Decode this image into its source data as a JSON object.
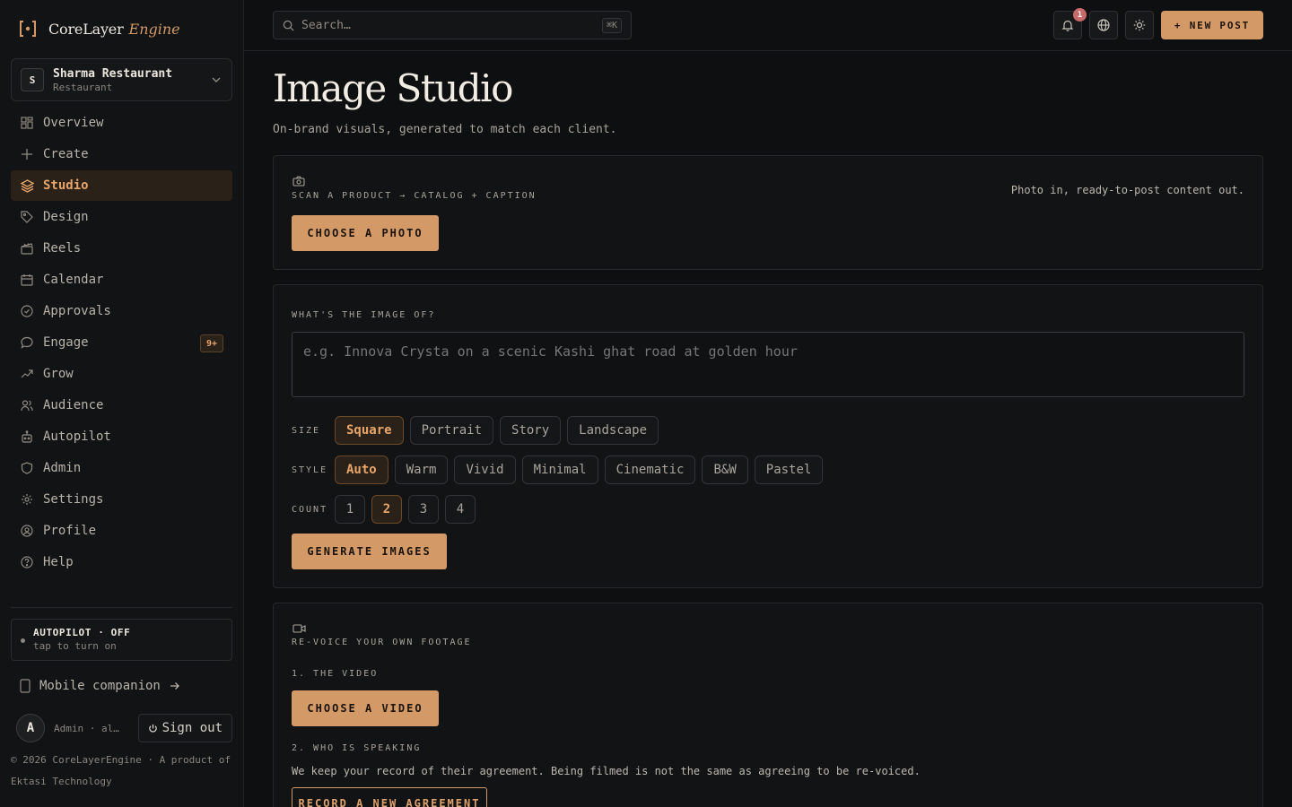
{
  "brand": {
    "name": "CoreLayer",
    "sub": "Engine"
  },
  "workspace": {
    "initial": "S",
    "name": "Sharma Restaurant",
    "type": "Restaurant"
  },
  "nav": [
    {
      "label": "Overview",
      "icon": "grid-icon"
    },
    {
      "label": "Create",
      "icon": "plus-icon"
    },
    {
      "label": "Studio",
      "icon": "layers-icon",
      "active": true
    },
    {
      "label": "Design",
      "icon": "tag-icon"
    },
    {
      "label": "Reels",
      "icon": "clapper-icon"
    },
    {
      "label": "Calendar",
      "icon": "calendar-icon"
    },
    {
      "label": "Approvals",
      "icon": "check-circle-icon"
    },
    {
      "label": "Engage",
      "icon": "chat-icon",
      "badge": "9+"
    },
    {
      "label": "Grow",
      "icon": "trending-up-icon"
    },
    {
      "label": "Audience",
      "icon": "users-icon"
    },
    {
      "label": "Autopilot",
      "icon": "bot-icon"
    },
    {
      "label": "Admin",
      "icon": "shield-icon"
    },
    {
      "label": "Settings",
      "icon": "gear-icon"
    },
    {
      "label": "Profile",
      "icon": "user-circle-icon"
    },
    {
      "label": "Help",
      "icon": "help-icon"
    }
  ],
  "autopilot": {
    "title": "AUTOPILOT · OFF",
    "sub": "tap to turn on"
  },
  "mobile": {
    "label": "Mobile companion"
  },
  "user": {
    "initial": "A",
    "email": "Admin · al…",
    "signout": "Sign out"
  },
  "footer": {
    "copy": "© 2026 CoreLayerEngine · A product of Ektasi Technology"
  },
  "topbar": {
    "search_placeholder": "Search…",
    "search_kbd": "⌘K",
    "notif_count": "1",
    "new_post": "+ NEW POST"
  },
  "page": {
    "title": "Image Studio",
    "subtitle": "On-brand visuals, generated to match each client."
  },
  "scan": {
    "eyebrow": "SCAN A PRODUCT → CATALOG + CAPTION",
    "hint": "Photo in, ready-to-post content out.",
    "button": "CHOOSE A PHOTO"
  },
  "generate": {
    "eyebrow": "WHAT'S THE IMAGE OF?",
    "placeholder": "e.g. Innova Crysta on a scenic Kashi ghat road at golden hour",
    "size_label": "SIZE",
    "sizes": [
      "Square",
      "Portrait",
      "Story",
      "Landscape"
    ],
    "size_selected": "Square",
    "style_label": "STYLE",
    "styles": [
      "Auto",
      "Warm",
      "Vivid",
      "Minimal",
      "Cinematic",
      "B&W",
      "Pastel"
    ],
    "style_selected": "Auto",
    "count_label": "COUNT",
    "counts": [
      "1",
      "2",
      "3",
      "4"
    ],
    "count_selected": "2",
    "button": "GENERATE IMAGES"
  },
  "revoice": {
    "eyebrow": "RE-VOICE YOUR OWN FOOTAGE",
    "step1": "1. THE VIDEO",
    "video_button": "CHOOSE A VIDEO",
    "step2": "2. WHO IS SPEAKING",
    "note": "We keep your record of their agreement. Being filmed is not the same as agreeing to be re-voiced.",
    "agreement_button": "RECORD A NEW AGREEMENT"
  },
  "colors": {
    "accent": "#d39a67",
    "accent_text": "#e9a66b",
    "bg": "#0e0f10",
    "badge": "#c96a6a"
  }
}
